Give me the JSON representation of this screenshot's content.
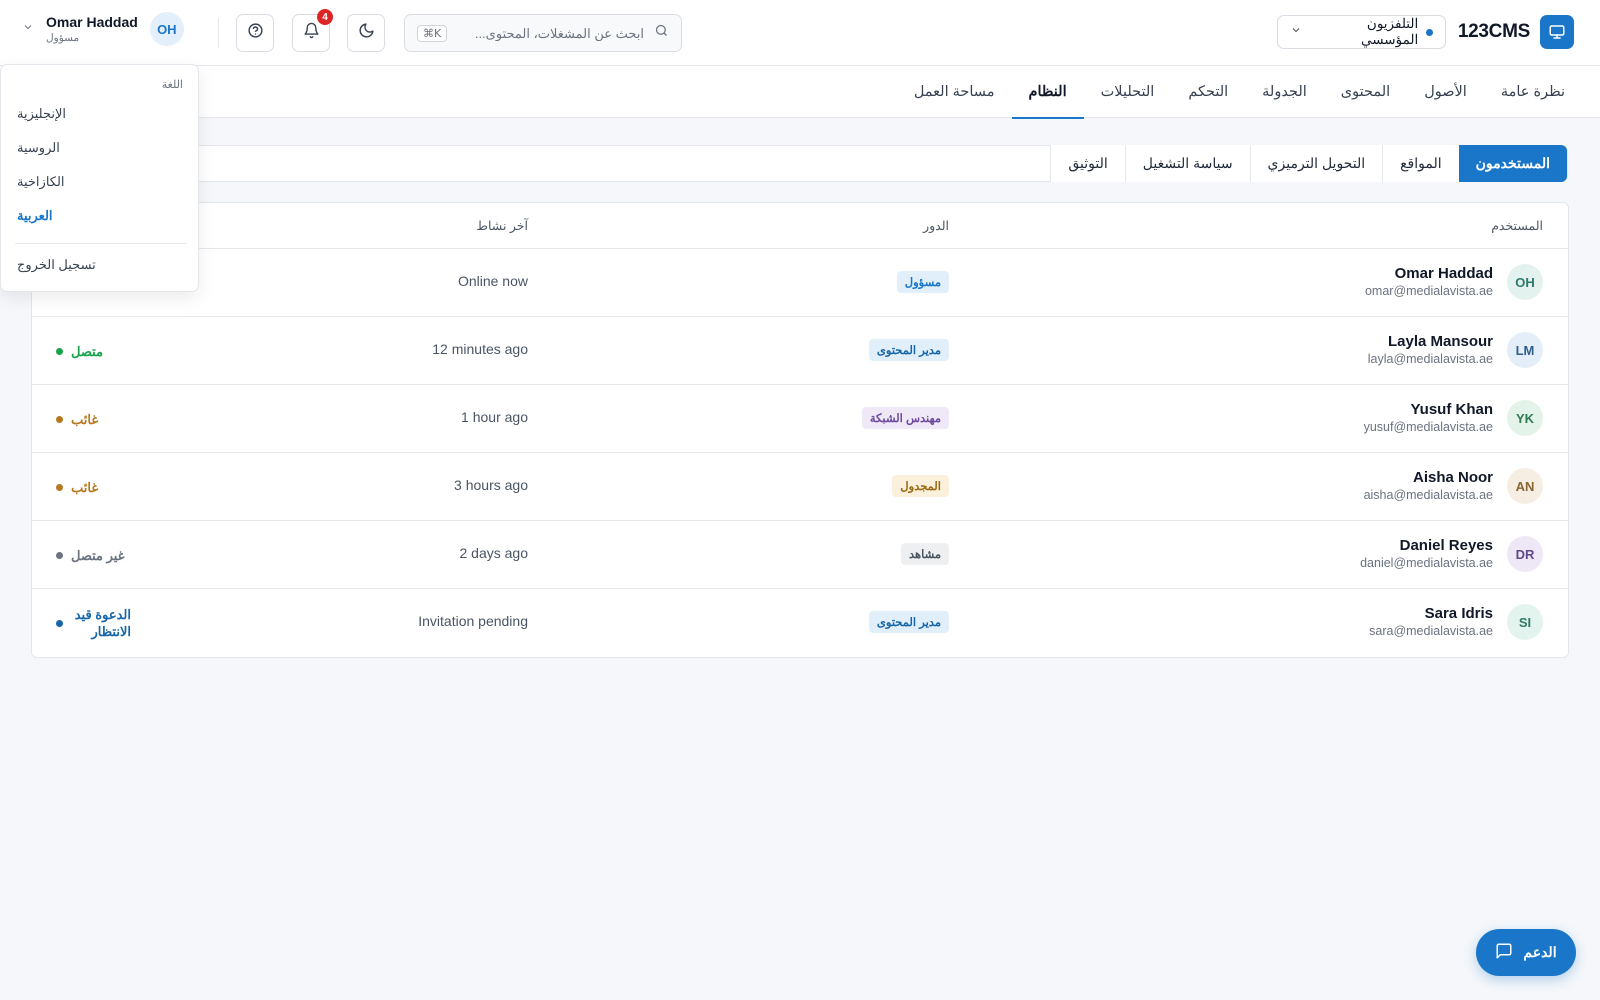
{
  "header": {
    "brand_name": "123CMS",
    "brand_icon": "monitor-icon",
    "org_select": "التلفزيون المؤسسي",
    "search_placeholder": "ابحث عن المشغلات، المحتوى...",
    "search_shortcut": "⌘K",
    "notifications_count": "4",
    "user_name": "Omar Haddad",
    "user_role": "مسؤول",
    "user_initials": "OH"
  },
  "nav": {
    "items": [
      "نظرة عامة",
      "الأصول",
      "المحتوى",
      "الجدولة",
      "التحكم",
      "التحليلات",
      "النظام",
      "مساحة العمل"
    ],
    "active": "النظام"
  },
  "subtabs": {
    "items": [
      "المستخدمون",
      "المواقع",
      "التحويل الترميزي",
      "سياسة التشغيل",
      "التوثيق"
    ],
    "active": "المستخدمون"
  },
  "table": {
    "columns": {
      "user": "المستخدم",
      "role": "الدور",
      "last_activity": "آخر نشاط"
    },
    "rows": [
      {
        "initials": "OH",
        "name": "Omar Haddad",
        "email": "omar@medialavista.ae",
        "role": "مسؤول",
        "last": "Online now",
        "status": ""
      },
      {
        "initials": "LM",
        "name": "Layla Mansour",
        "email": "layla@medialavista.ae",
        "role": "مدير المحتوى",
        "last": "12 minutes ago",
        "status": "متصل"
      },
      {
        "initials": "YK",
        "name": "Yusuf Khan",
        "email": "yusuf@medialavista.ae",
        "role": "مهندس الشبكة",
        "last": "1 hour ago",
        "status": "غائب"
      },
      {
        "initials": "AN",
        "name": "Aisha Noor",
        "email": "aisha@medialavista.ae",
        "role": "المجدول",
        "last": "3 hours ago",
        "status": "غائب"
      },
      {
        "initials": "DR",
        "name": "Daniel Reyes",
        "email": "daniel@medialavista.ae",
        "role": "مشاهد",
        "last": "2 days ago",
        "status": "غير متصل"
      },
      {
        "initials": "SI",
        "name": "Sara Idris",
        "email": "sara@medialavista.ae",
        "role": "مدير المحتوى",
        "last": "Invitation pending",
        "status": "الدعوة قيد الانتظار"
      }
    ]
  },
  "dropdown": {
    "header": "اللغة",
    "options": [
      "الإنجليزية",
      "الروسية",
      "الكازاخية",
      "العربية"
    ],
    "selected": "العربية",
    "logout": "تسجيل الخروج"
  },
  "support": {
    "label": "الدعم",
    "icon": "chat-icon"
  },
  "colors": {
    "accent": "#1976c9",
    "online": "#16a34a",
    "away": "#b7791f",
    "offline": "#6b7280",
    "badge": "#dc2626"
  }
}
